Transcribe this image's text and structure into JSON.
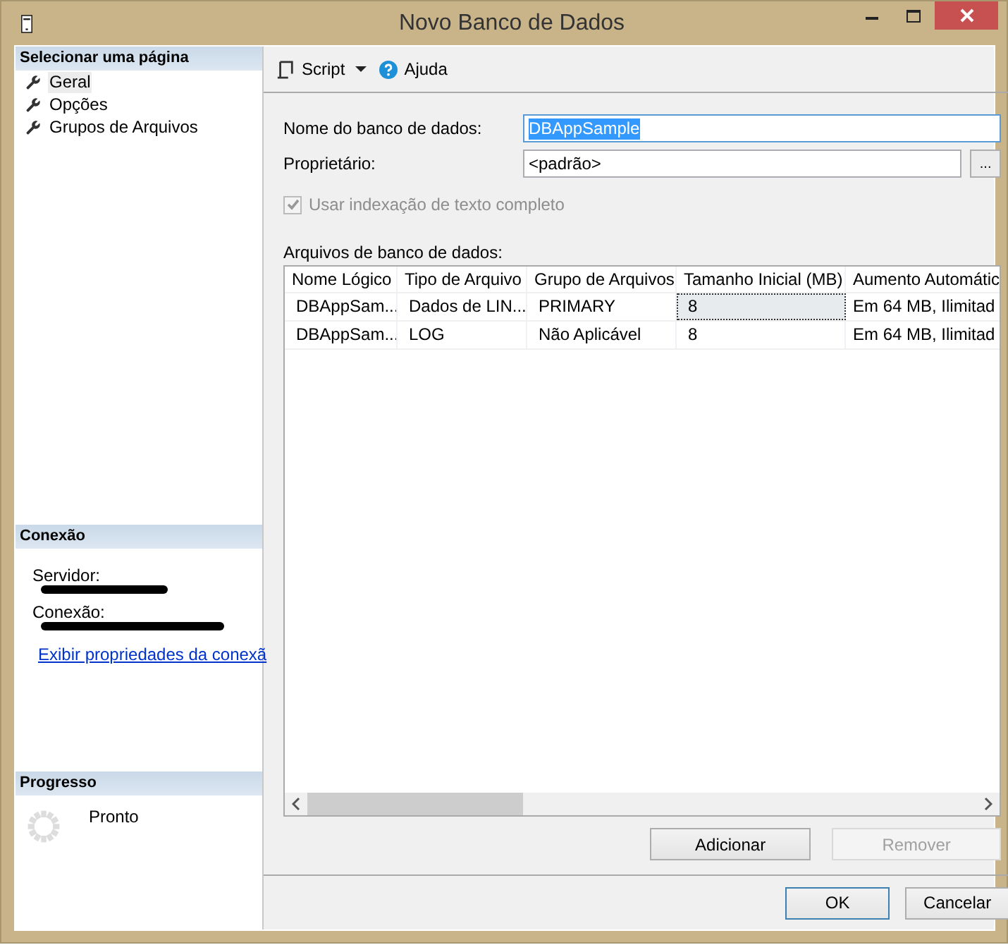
{
  "window": {
    "title": "Novo Banco de Dados"
  },
  "sidebar": {
    "header": "Selecionar uma página",
    "items": [
      {
        "label": "Geral",
        "selected": true
      },
      {
        "label": "Opções",
        "selected": false
      },
      {
        "label": "Grupos de Arquivos",
        "selected": false
      }
    ]
  },
  "connection": {
    "header": "Conexão",
    "fields": [
      {
        "label": "Servidor:"
      },
      {
        "label": "Conexão:"
      }
    ],
    "link": "Exibir propriedades da conexã"
  },
  "progress": {
    "header": "Progresso",
    "status": "Pronto"
  },
  "toolbar": {
    "items": [
      {
        "kind": "script",
        "label": "Script"
      },
      {
        "kind": "help",
        "label": "Ajuda"
      }
    ]
  },
  "form": {
    "name_label": "Nome do banco de dados:",
    "name_value": "DBAppSample",
    "owner_label": "Proprietário:",
    "owner_value": "<padrão>",
    "browse_label": "...",
    "fulltext": {
      "label": "Usar indexação de texto completo",
      "checked": true,
      "disabled": true
    }
  },
  "files": {
    "label": "Arquivos de banco de dados:",
    "columns": [
      "Nome Lógico",
      "Tipo de Arquivo",
      "Grupo de Arquivos",
      "Tamanho Inicial (MB)",
      "Aumento Automátic"
    ],
    "rows": [
      {
        "cells": [
          {
            "text": "DBAppSam...",
            "focused": false
          },
          {
            "text": "Dados de LIN...",
            "focused": false
          },
          {
            "text": "PRIMARY",
            "focused": false
          },
          {
            "text": "8",
            "focused": true
          },
          {
            "text": "Em 64 MB, Ilimitad",
            "focused": false
          }
        ]
      },
      {
        "cells": [
          {
            "text": "DBAppSam...",
            "focused": false
          },
          {
            "text": "LOG",
            "focused": false
          },
          {
            "text": "Não Aplicável",
            "focused": false
          },
          {
            "text": "8",
            "focused": false
          },
          {
            "text": "Em 64 MB, Ilimitad",
            "focused": false
          }
        ]
      }
    ],
    "buttons": [
      {
        "label": "Adicionar",
        "disabled": false
      },
      {
        "label": "Remover",
        "disabled": true
      }
    ]
  },
  "dialog_buttons": [
    {
      "label": "OK",
      "default": true
    },
    {
      "label": "Cancelar",
      "default": false
    }
  ]
}
